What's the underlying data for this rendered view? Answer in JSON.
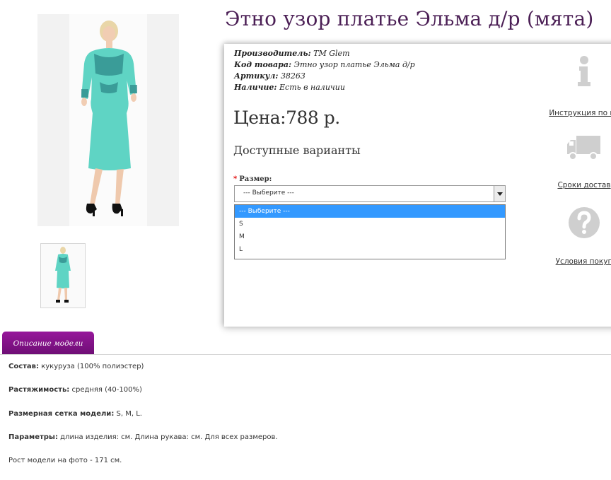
{
  "product": {
    "title": "Этно узор платье Эльма д/р (мята)",
    "image_alt": "model-in-mint-dress",
    "thumb_alt": "thumbnail-mint-dress"
  },
  "meta": {
    "manufacturer_label": "Производитель:",
    "manufacturer_value": "TM Glem",
    "code_label": "Код товара:",
    "code_value": "Этно узор платье Эльма д/р",
    "sku_label": "Артикул:",
    "sku_value": "38263",
    "stock_label": "Наличие:",
    "stock_value": "Есть в наличии"
  },
  "price": "Цена:788 р.",
  "variants_heading": "Доступные варианты",
  "size": {
    "required_mark": "*",
    "label": "Размер:",
    "selected": "--- Выберите ---",
    "options": [
      "--- Выберите ---",
      "S",
      "M",
      "L"
    ]
  },
  "info_links": {
    "instruction": "Инструкция по по",
    "delivery": "Сроки достав",
    "purchase": "Условия покуп"
  },
  "tabs": {
    "description": "Описание модели"
  },
  "description": {
    "composition_label": "Состав:",
    "composition_value": "кукуруза (100% полиэстер)",
    "stretch_label": "Растяжимость:",
    "stretch_value": "средняя (40-100%)",
    "sizes_label": "Размерная сетка модели:",
    "sizes_value": "S, M, L.",
    "params_label": "Параметры:",
    "params_value": "длина изделия: см. Длина рукава: см. Для всех размеров.",
    "model_height": "Рост модели на фото - 171 см."
  },
  "colors": {
    "title": "#4b1f55",
    "tab_bg": "#8a1490",
    "dropdown_highlight": "#3399ff",
    "dress": "#5fd4c4",
    "icon_gray": "#cfcfcf"
  }
}
